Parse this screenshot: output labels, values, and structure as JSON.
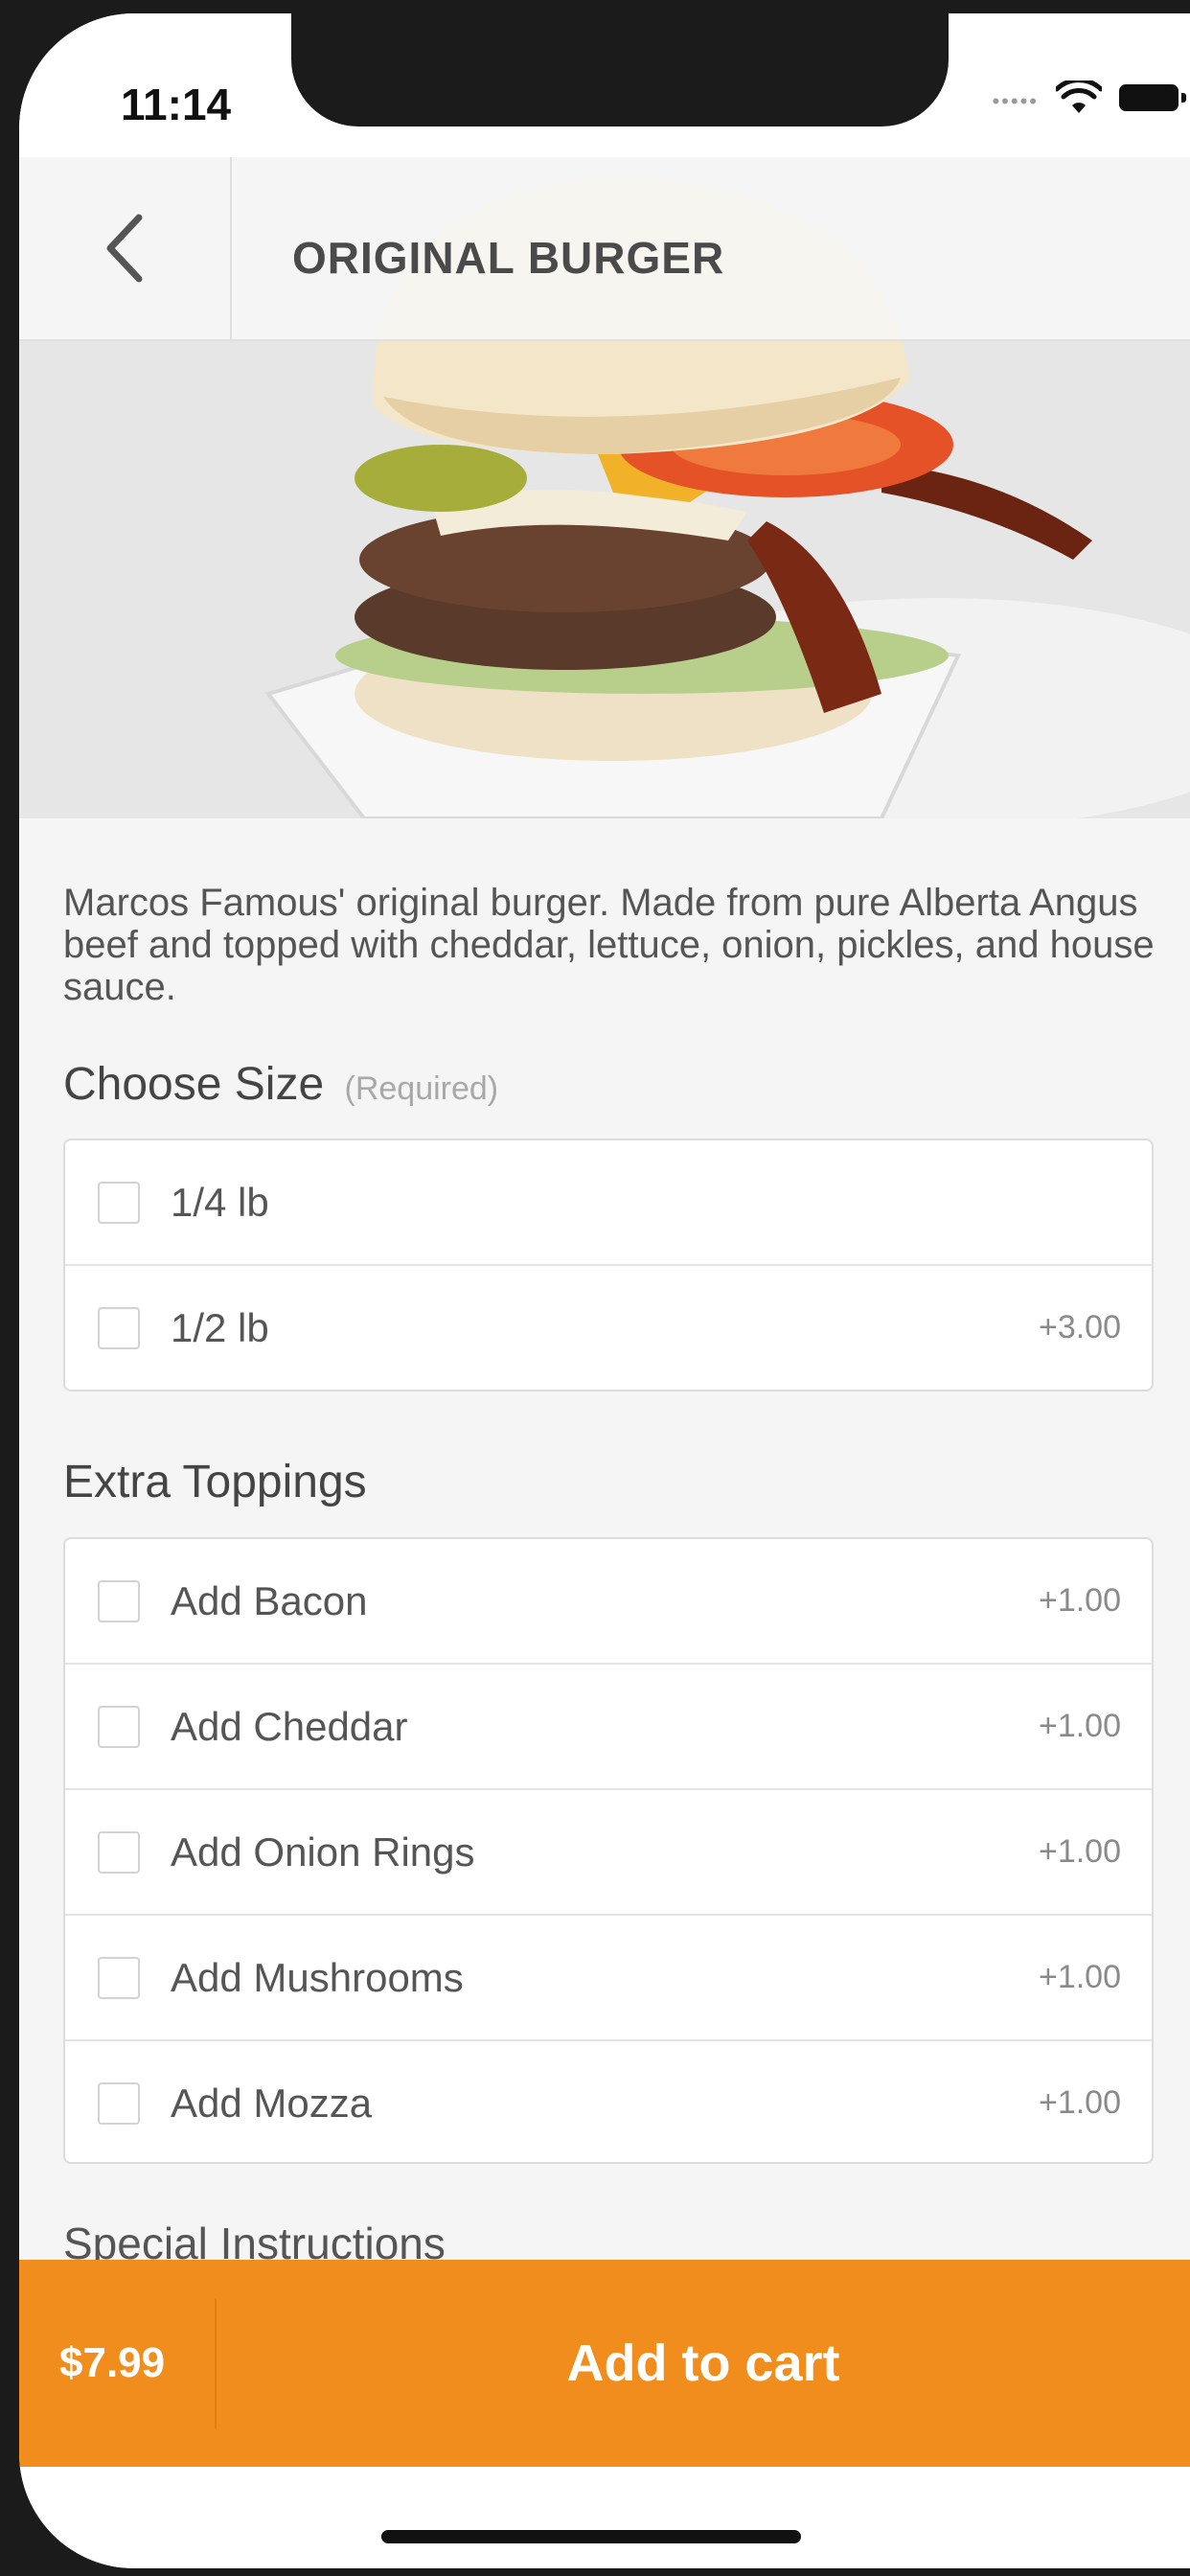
{
  "status_bar": {
    "time": "11:14",
    "icons": [
      "signal-dots-icon",
      "wifi-icon",
      "battery-icon"
    ]
  },
  "header": {
    "back_icon": "chevron-left-icon",
    "title": "ORIGINAL BURGER"
  },
  "hero": {
    "image_subject": "burger-photo"
  },
  "description": "Marcos Famous' original burger. Made from pure Alberta Angus beef and topped with cheddar, lettuce, onion, pickles, and house sauce.",
  "size_section": {
    "title": "Choose Size",
    "required_label": "(Required)",
    "options": [
      {
        "label": "1/4 lb",
        "price": ""
      },
      {
        "label": "1/2 lb",
        "price": "+3.00"
      }
    ]
  },
  "toppings_section": {
    "title": "Extra Toppings",
    "options": [
      {
        "label": "Add Bacon",
        "price": "+1.00"
      },
      {
        "label": "Add Cheddar",
        "price": "+1.00"
      },
      {
        "label": "Add Onion Rings",
        "price": "+1.00"
      },
      {
        "label": "Add Mushrooms",
        "price": "+1.00"
      },
      {
        "label": "Add Mozza",
        "price": "+1.00"
      }
    ]
  },
  "special_instructions": {
    "title": "Special Instructions"
  },
  "cart": {
    "price": "$7.99",
    "button_label": "Add to cart"
  },
  "colors": {
    "accent": "#f08d1c",
    "background": "#f5f5f5",
    "text": "#555555"
  }
}
